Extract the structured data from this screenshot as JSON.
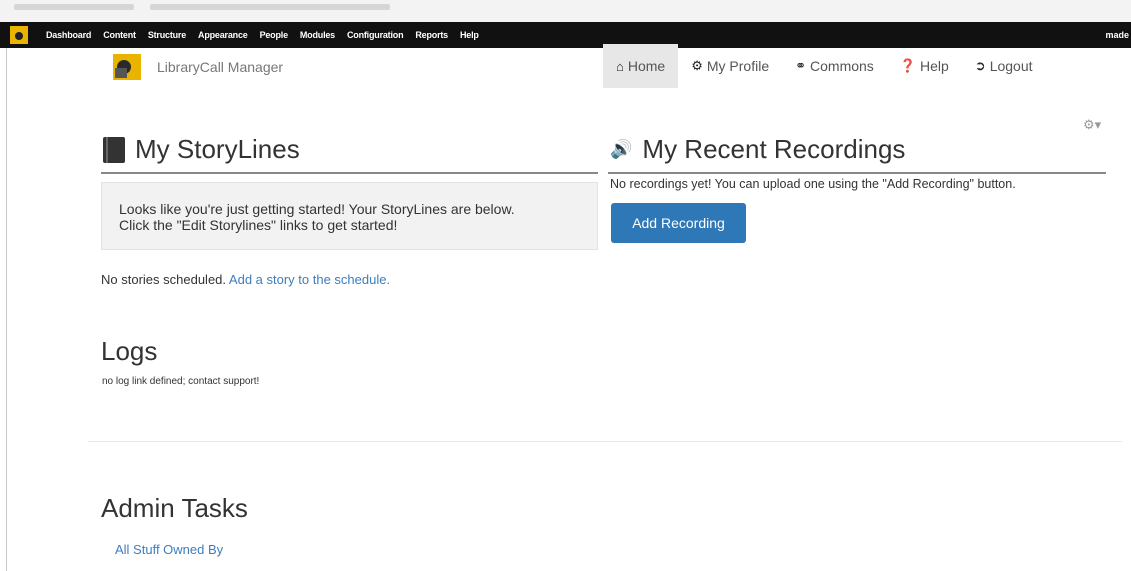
{
  "admin_bar": {
    "menu": [
      "Dashboard",
      "Content",
      "Structure",
      "Appearance",
      "People",
      "Modules",
      "Configuration",
      "Reports",
      "Help"
    ],
    "user": "made"
  },
  "brand": {
    "name": "LibraryCall Manager"
  },
  "nav": [
    {
      "label": "Home",
      "icon": "home-icon",
      "active": true
    },
    {
      "label": "My Profile",
      "icon": "gear-icon",
      "active": false
    },
    {
      "label": "Commons",
      "icon": "headphones-icon",
      "active": false
    },
    {
      "label": "Help",
      "icon": "question-icon",
      "active": false
    },
    {
      "label": "Logout",
      "icon": "logout-icon",
      "active": false
    }
  ],
  "storylines": {
    "title": "My StoryLines",
    "welcome_line1": "Looks like you're just getting started! Your StoryLines are below.",
    "welcome_line2": "Click the \"Edit Storylines\" links to get started!",
    "no_stories": "No stories scheduled.",
    "add_story_link": "Add a story to the schedule."
  },
  "recordings": {
    "title": "My Recent Recordings",
    "empty_text": "No recordings yet! You can upload one using the \"Add Recording\" button.",
    "add_button": "Add Recording"
  },
  "logs": {
    "title": "Logs",
    "text": "no log link defined; contact support!"
  },
  "admin_tasks": {
    "title": "Admin Tasks",
    "link": "All Stuff Owned By"
  },
  "colors": {
    "admin_bar_bg": "#111111",
    "primary_button": "#2f78b8",
    "link": "#3d7ebf",
    "brand_logo": "#e8b400"
  }
}
